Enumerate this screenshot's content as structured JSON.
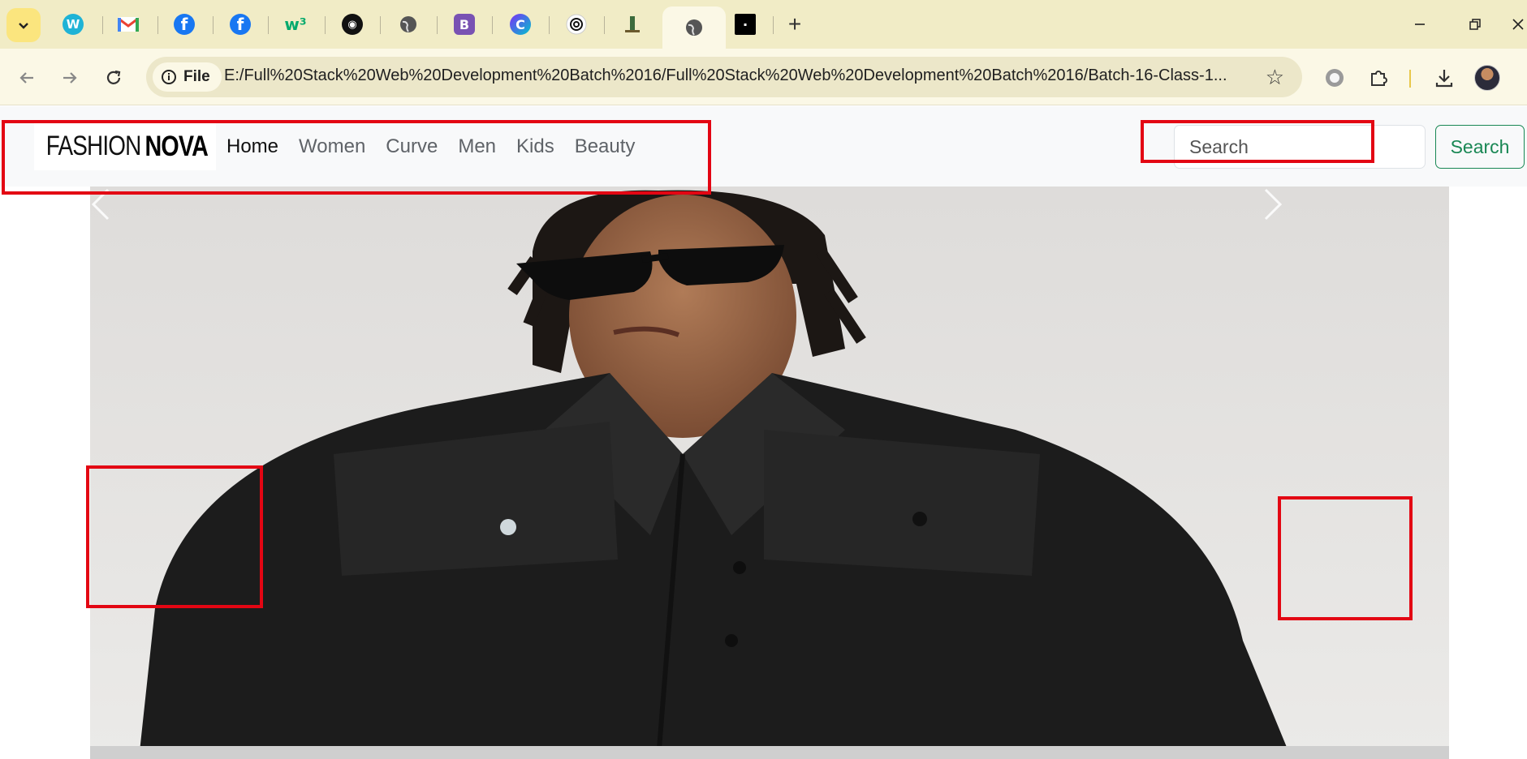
{
  "browser": {
    "tabs": [
      {
        "icon": "wiki-favicon-icon"
      },
      {
        "icon": "gmail-favicon-icon"
      },
      {
        "icon": "facebook-favicon-icon"
      },
      {
        "icon": "facebook-favicon-icon"
      },
      {
        "icon": "w3schools-favicon-icon"
      },
      {
        "icon": "github-favicon-icon"
      },
      {
        "icon": "globe-favicon-icon"
      },
      {
        "icon": "bootstrap-favicon-icon",
        "letter": "B"
      },
      {
        "icon": "canva-favicon-icon",
        "letter": "C"
      },
      {
        "icon": "chatgpt-favicon-icon"
      },
      {
        "icon": "site-favicon-icon"
      },
      {
        "icon": "globe-favicon-icon",
        "active": true
      },
      {
        "icon": "fashionnova-favicon-icon"
      }
    ],
    "site_info_label": "File",
    "url": "E:/Full%20Stack%20Web%20Development%20Batch%2016/Full%20Stack%20Web%20Development%20Batch%2016/Batch-16-Class-1..."
  },
  "navbar": {
    "brand": {
      "part1": "FASHION",
      "part2": "NOVA"
    },
    "links": [
      {
        "label": "Home",
        "active": true
      },
      {
        "label": "Women"
      },
      {
        "label": "Curve"
      },
      {
        "label": "Men"
      },
      {
        "label": "Kids"
      },
      {
        "label": "Beauty"
      }
    ],
    "search": {
      "placeholder": "Search",
      "button_label": "Search"
    }
  },
  "carousel": {
    "controls": {
      "prev_icon": "chevron-left-icon",
      "next_icon": "chevron-right-icon"
    }
  },
  "colors": {
    "annotation": "#e30613",
    "success": "#198754",
    "navbar_bg": "#f8f9fa"
  }
}
